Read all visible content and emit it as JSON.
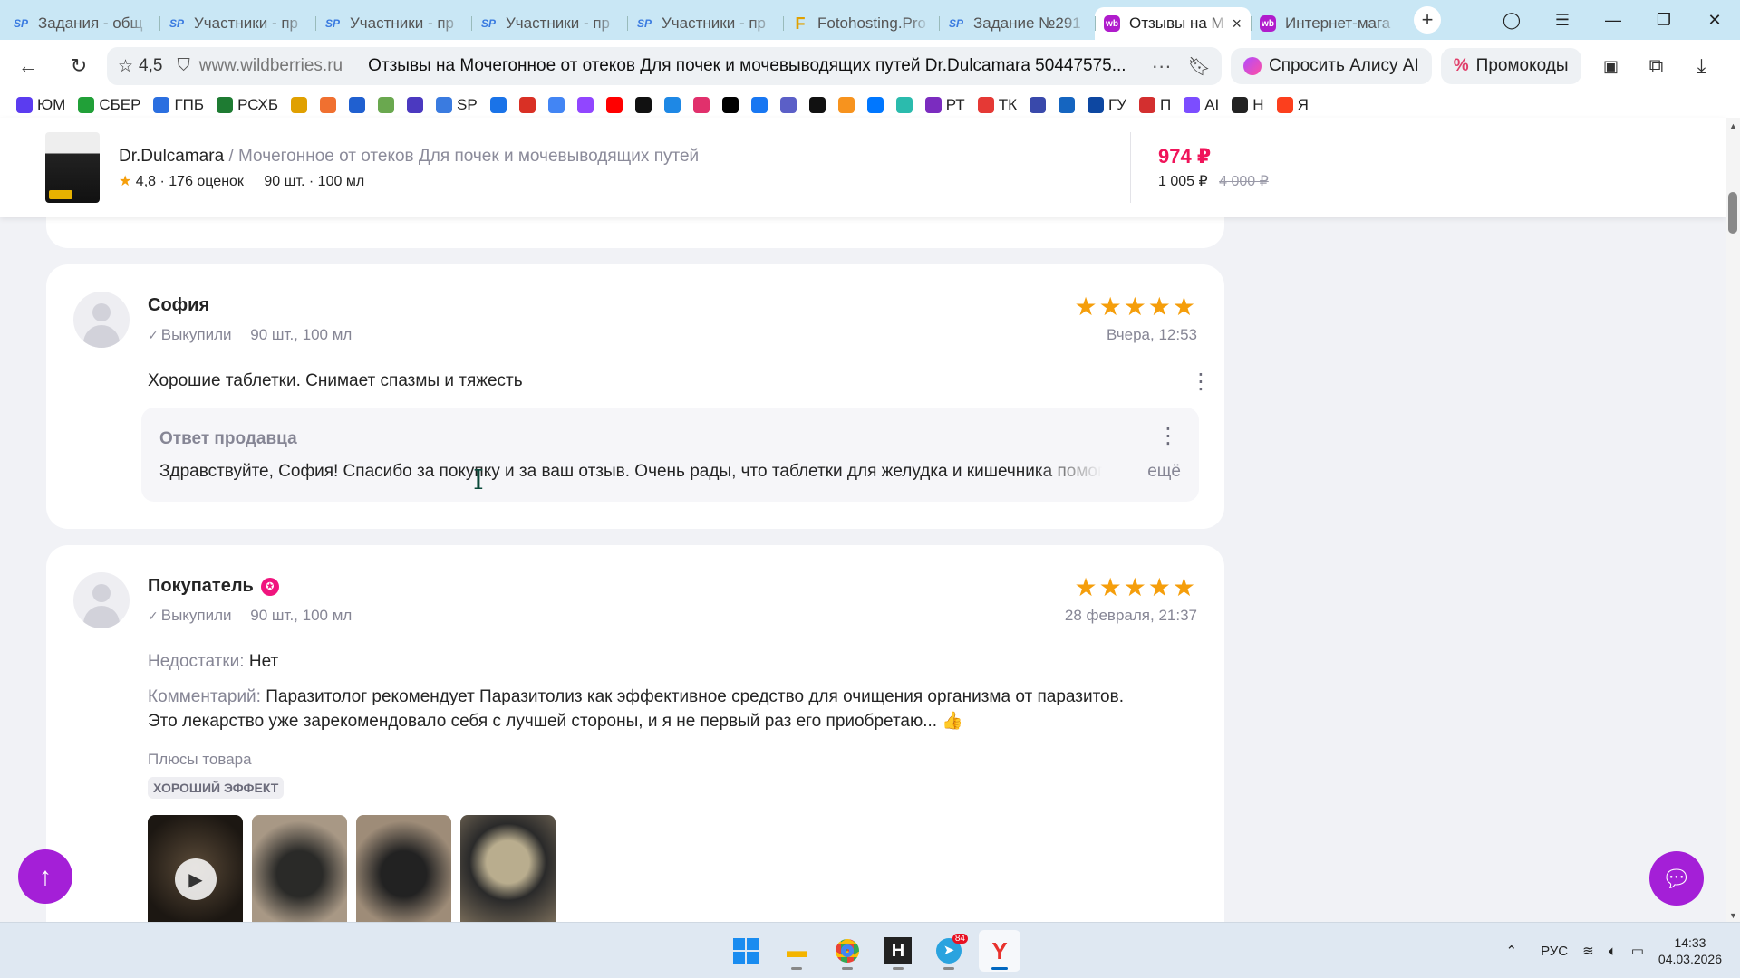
{
  "browser": {
    "tabs": [
      {
        "favicon": "sp",
        "icon_text": "SP",
        "title": "Задания - общ"
      },
      {
        "favicon": "sp",
        "icon_text": "SP",
        "title": "Участники - пр"
      },
      {
        "favicon": "sp",
        "icon_text": "SP",
        "title": "Участники - пр"
      },
      {
        "favicon": "sp",
        "icon_text": "SP",
        "title": "Участники - пр"
      },
      {
        "favicon": "sp",
        "icon_text": "SP",
        "title": "Участники - пр"
      },
      {
        "favicon": "fh",
        "icon_text": "F",
        "title": "Fotohosting.Pro"
      },
      {
        "favicon": "sp",
        "icon_text": "SP",
        "title": "Задание №291"
      },
      {
        "favicon": "wb",
        "icon_text": "wb",
        "title": "Отзывы на М",
        "active": true
      },
      {
        "favicon": "wb",
        "icon_text": "wb",
        "title": "Интернет-мага"
      }
    ],
    "new_tab": "+",
    "address": {
      "rating": "4,5",
      "host": "www.wildberries.ru",
      "page_title": "Отзывы на Мочегонное от отеков Для почек и мочевыводящих путей Dr.Dulcamara 50447575..."
    },
    "alice_button": "Спросить Алису AI",
    "promo_button": "Промокоды",
    "bookmarks": [
      {
        "label": "ЮМ",
        "color": "#5b3cf0"
      },
      {
        "label": "СБЕР",
        "color": "#21a038"
      },
      {
        "label": "ГПБ",
        "color": "#2b6fe0"
      },
      {
        "label": "РСХБ",
        "color": "#1e7b32"
      },
      {
        "label": "",
        "color": "#e0a000"
      },
      {
        "label": "",
        "color": "#f07030"
      },
      {
        "label": "",
        "color": "#2060d0"
      },
      {
        "label": "",
        "color": "#6aa84f"
      },
      {
        "label": "",
        "color": "#4b39c0"
      },
      {
        "label": "SP",
        "color": "#3a7be0"
      },
      {
        "label": "",
        "color": "#1a73e8"
      },
      {
        "label": "",
        "color": "#d93025"
      },
      {
        "label": "",
        "color": "#4285f4"
      },
      {
        "label": "",
        "color": "#9146ff"
      },
      {
        "label": "",
        "color": "#ff0000"
      },
      {
        "label": "",
        "color": "#111111"
      },
      {
        "label": "",
        "color": "#1e88e5"
      },
      {
        "label": "",
        "color": "#e1306c"
      },
      {
        "label": "",
        "color": "#000000"
      },
      {
        "label": "",
        "color": "#1877f2"
      },
      {
        "label": "",
        "color": "#5b5fc7"
      },
      {
        "label": "",
        "color": "#111111"
      },
      {
        "label": "",
        "color": "#f7931e"
      },
      {
        "label": "",
        "color": "#0077ff"
      },
      {
        "label": "",
        "color": "#2bbbad"
      },
      {
        "label": "РТ",
        "color": "#7b2cbf"
      },
      {
        "label": "ТК",
        "color": "#e53935"
      },
      {
        "label": "",
        "color": "#3949ab"
      },
      {
        "label": "",
        "color": "#1565c0"
      },
      {
        "label": "ГУ",
        "color": "#0d47a1"
      },
      {
        "label": "П",
        "color": "#d32f2f"
      },
      {
        "label": "AI",
        "color": "#7c4dff"
      },
      {
        "label": "Н",
        "color": "#222222"
      },
      {
        "label": "Я",
        "color": "#fc3f1d"
      }
    ]
  },
  "product_header": {
    "brand": "Dr.Dulcamara",
    "separator": "/",
    "name": "Мочегонное от отеков Для почек и мочевыводящих путей",
    "rating": "4,8",
    "ratings_count": "176 оценок",
    "attributes": "90 шт. · 100 мл",
    "price": "974 ₽",
    "price_wallet": "1 005 ₽",
    "price_old": "4 000 ₽"
  },
  "reviews": [
    {
      "author": "София",
      "bought": "Выкупили",
      "variant": "90 шт., 100 мл",
      "rating": 5,
      "stars": "★★★★★",
      "date": "Вчера, 12:53",
      "text": "Хорошие таблетки. Снимает спазмы и тяжесть",
      "reply_title": "Ответ продавца",
      "reply_text": "Здравствуйте, София! Спасибо за покупку и за ваш отзыв. Очень рады, что таблетки для желудка и кишечника помогли",
      "reply_more": "ещё"
    },
    {
      "author": "Покупатель",
      "bought": "Выкупили",
      "variant": "90 шт., 100 мл",
      "rating": 5,
      "stars": "★★★★★",
      "date": "28 февраля, 21:37",
      "cons_label": "Недостатки:",
      "cons_value": "Нет",
      "comment_label": "Комментарий:",
      "comment_value": "Паразитолог рекомендует Паразитолиз как эффективное средство для очищения организма от паразитов. Это лекарство уже зарекомендовало себя с лучшей стороны, и я не первый раз его приобретаю... 👍",
      "pros_title": "Плюсы товара",
      "tag": "ХОРОШИЙ ЭФФЕКТ"
    }
  ],
  "taskbar": {
    "language": "РУС",
    "time": "14:33",
    "date": "04.03.2026",
    "telegram_badge": "84"
  },
  "colors": {
    "accent": "#a41fd7",
    "price": "#f0145a",
    "star": "#f59e0b"
  }
}
